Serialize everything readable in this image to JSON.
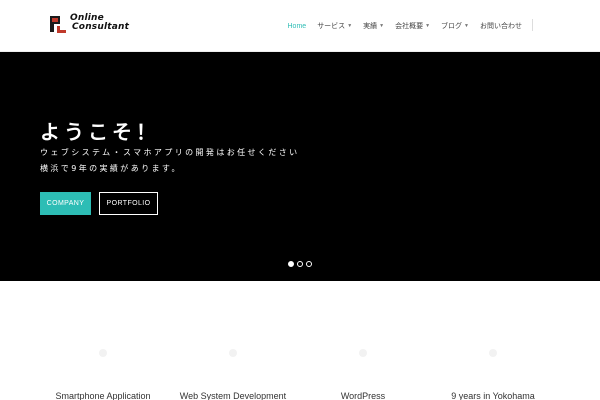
{
  "brand": {
    "line1": "Online",
    "line2": "Consultant",
    "logo_colors": {
      "dark": "#1a1a1a",
      "red": "#c0392b"
    }
  },
  "nav": {
    "items": [
      {
        "label": "Home",
        "active": true,
        "has_dropdown": false
      },
      {
        "label": "サービス",
        "active": false,
        "has_dropdown": true
      },
      {
        "label": "実績",
        "active": false,
        "has_dropdown": true
      },
      {
        "label": "会社概要",
        "active": false,
        "has_dropdown": true
      },
      {
        "label": "ブログ",
        "active": false,
        "has_dropdown": true
      },
      {
        "label": "お問い合わせ",
        "active": false,
        "has_dropdown": false
      }
    ],
    "chevron_icon": "chevron-down-icon",
    "active_color": "#2dbdb5"
  },
  "hero": {
    "title": "ようこそ！",
    "line1": "ウェブシステム・スマホアプリの開発はお任せください",
    "line2": "横浜で9年の実績があります。",
    "company_button": "COMPANY",
    "portfolio_button": "PORTFOLIO",
    "slides": {
      "count": 3,
      "active_index": 0
    },
    "background": "#000000",
    "accent": "#2dbdb5"
  },
  "features": [
    {
      "label": "Smartphone Application",
      "icon": "phone-icon"
    },
    {
      "label": "Web System Development",
      "icon": "code-icon"
    },
    {
      "label": "WordPress",
      "icon": "wordpress-icon"
    },
    {
      "label": "9 years in Yokohama",
      "icon": "location-icon"
    }
  ]
}
